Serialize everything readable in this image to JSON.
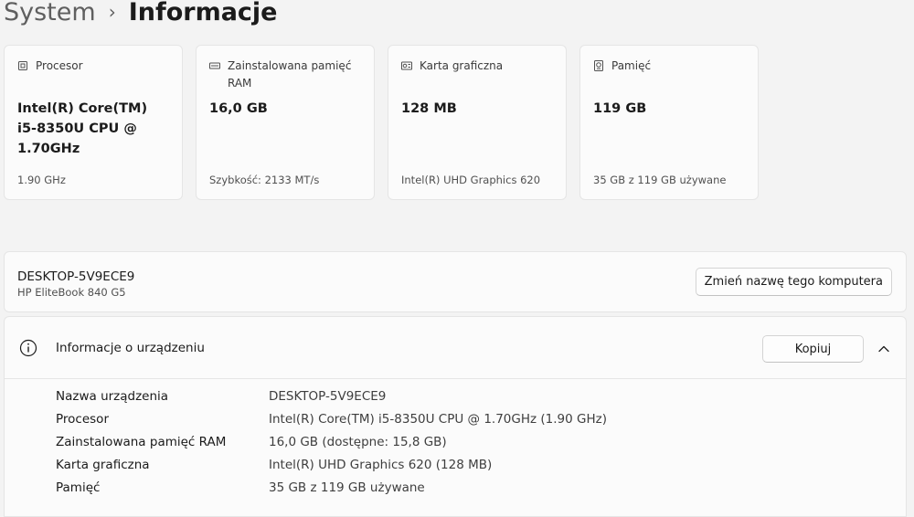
{
  "breadcrumb": {
    "parent": "System",
    "separator": "›",
    "current": "Informacje"
  },
  "cards": [
    {
      "icon": "processor-chip-icon",
      "label": "Procesor",
      "value": "Intel(R) Core(TM) i5-8350U CPU @ 1.70GHz",
      "detail": "1.90 GHz"
    },
    {
      "icon": "ram-memory-icon",
      "label": "Zainstalowana pamięć RAM",
      "value": "16,0 GB",
      "detail": "Szybkość: 2133 MT/s"
    },
    {
      "icon": "graphics-card-icon",
      "label": "Karta graficzna",
      "value": "128 MB",
      "detail": "Intel(R) UHD Graphics 620"
    },
    {
      "icon": "storage-drive-icon",
      "label": "Pamięć",
      "value": "119 GB",
      "detail": "35 GB z 119 GB używane"
    }
  ],
  "device": {
    "name": "DESKTOP-5V9ECE9",
    "model": "HP EliteBook 840 G5",
    "rename_label": "Zmień nazwę tego komputera"
  },
  "specs": {
    "title": "Informacje o urządzeniu",
    "copy_label": "Kopiuj",
    "rows": [
      {
        "label": "Nazwa urządzenia",
        "value": "DESKTOP-5V9ECE9"
      },
      {
        "label": "Procesor",
        "value": "Intel(R) Core(TM) i5-8350U CPU @ 1.70GHz (1.90 GHz)"
      },
      {
        "label": "Zainstalowana pamięć RAM",
        "value": "16,0 GB (dostępne: 15,8 GB)"
      },
      {
        "label": "Karta graficzna",
        "value": "Intel(R) UHD Graphics 620 (128 MB)"
      },
      {
        "label": "Pamięć",
        "value": "35 GB z 119 GB używane"
      }
    ]
  },
  "colors": {
    "background": "#f3f3f3",
    "card": "#fbfbfb",
    "border": "#e5e5e5"
  }
}
